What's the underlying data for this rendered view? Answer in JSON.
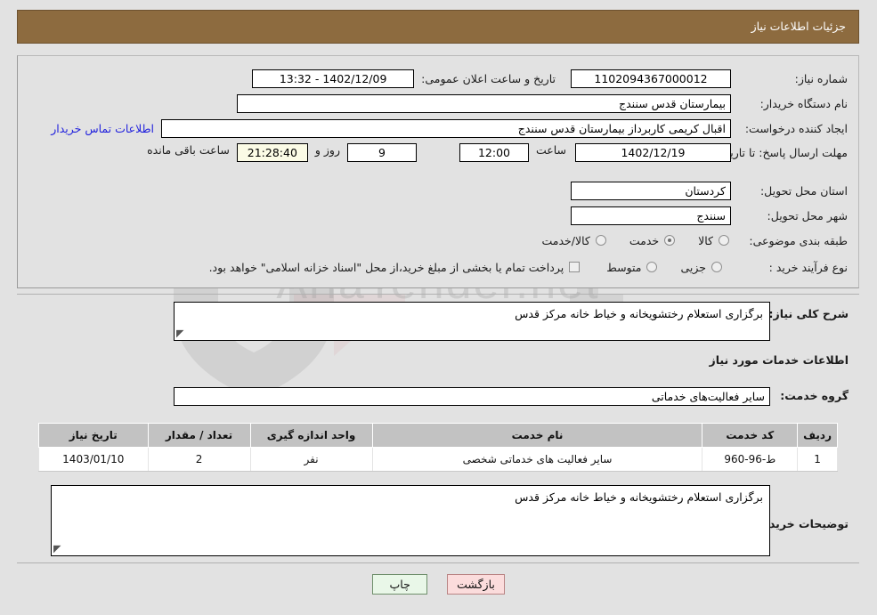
{
  "header": {
    "title": "جزئیات اطلاعات نیاز"
  },
  "colors": {
    "header_bar": "#8d6b3f",
    "link": "#2222dd",
    "table_header": "#c2c2c2",
    "countdown_field": "#fbfbe6",
    "print_button": "#e9f7e8",
    "back_button": "#fbdcdc"
  },
  "form": {
    "need_number_label": "شماره نیاز:",
    "need_number_value": "1102094367000012",
    "announce_datetime_label": "تاریخ و ساعت اعلان عمومی:",
    "announce_datetime_value": "1402/12/09 - 13:32",
    "buyer_org_label": "نام دستگاه خریدار:",
    "buyer_org_value": "بیمارستان قدس سنندج",
    "requester_label": "ایجاد کننده درخواست:",
    "requester_value": "اقبال کریمی کاربرداز بیمارستان قدس سنندج",
    "contact_link": "اطلاعات تماس خریدار",
    "deadline_label": "مهلت ارسال پاسخ: تا تاریخ:",
    "deadline_date": "1402/12/19",
    "hour_label": "ساعت",
    "hour_value": "12:00",
    "days_value": "9",
    "days_label": "روز و",
    "countdown_value": "21:28:40",
    "countdown_label": "ساعت باقی مانده",
    "province_label": "استان محل تحویل:",
    "province_value": "کردستان",
    "city_label": "شهر محل تحویل:",
    "city_value": "سنندج",
    "classification_label": "طبقه بندی موضوعی:",
    "classification_options": [
      {
        "label": "کالا",
        "selected": false
      },
      {
        "label": "خدمت",
        "selected": true
      },
      {
        "label": "کالا/خدمت",
        "selected": false
      }
    ],
    "process_type_label": "نوع فرآیند خرید :",
    "process_type_options": [
      {
        "label": "جزیی",
        "selected": false
      },
      {
        "label": "متوسط",
        "selected": false
      }
    ],
    "treasury_checkbox_checked": false,
    "treasury_note": "پرداخت تمام یا بخشی از مبلغ خرید،از محل \"اسناد خزانه اسلامی\" خواهد بود."
  },
  "description": {
    "general_label": "شرح کلی نیاز:",
    "general_value": "برگزاری استعلام رختشویخانه و خیاط خانه  مرکز قدس",
    "services_section_title": "اطلاعات خدمات مورد نیاز",
    "service_group_label": "گروه خدمت:",
    "service_group_value": "سایر فعالیت‌های خدماتی"
  },
  "table": {
    "headers": [
      "ردیف",
      "کد خدمت",
      "نام خدمت",
      "واحد اندازه گیری",
      "تعداد / مقدار",
      "تاریخ نیاز"
    ],
    "rows": [
      {
        "row_no": "1",
        "service_code": "ط-96-960",
        "service_name": "سایر فعالیت های خدماتی شخصی",
        "unit": "نفر",
        "quantity": "2",
        "need_date": "1403/01/10"
      }
    ]
  },
  "buyer_notes": {
    "label": "توضیحات خریدار:",
    "value": "برگزاری استعلام رختشویخانه و خیاط خانه  مرکز قدس"
  },
  "buttons": {
    "print": "چاپ",
    "back": "بازگشت"
  },
  "watermark": {
    "text": "AriaTender.net"
  }
}
